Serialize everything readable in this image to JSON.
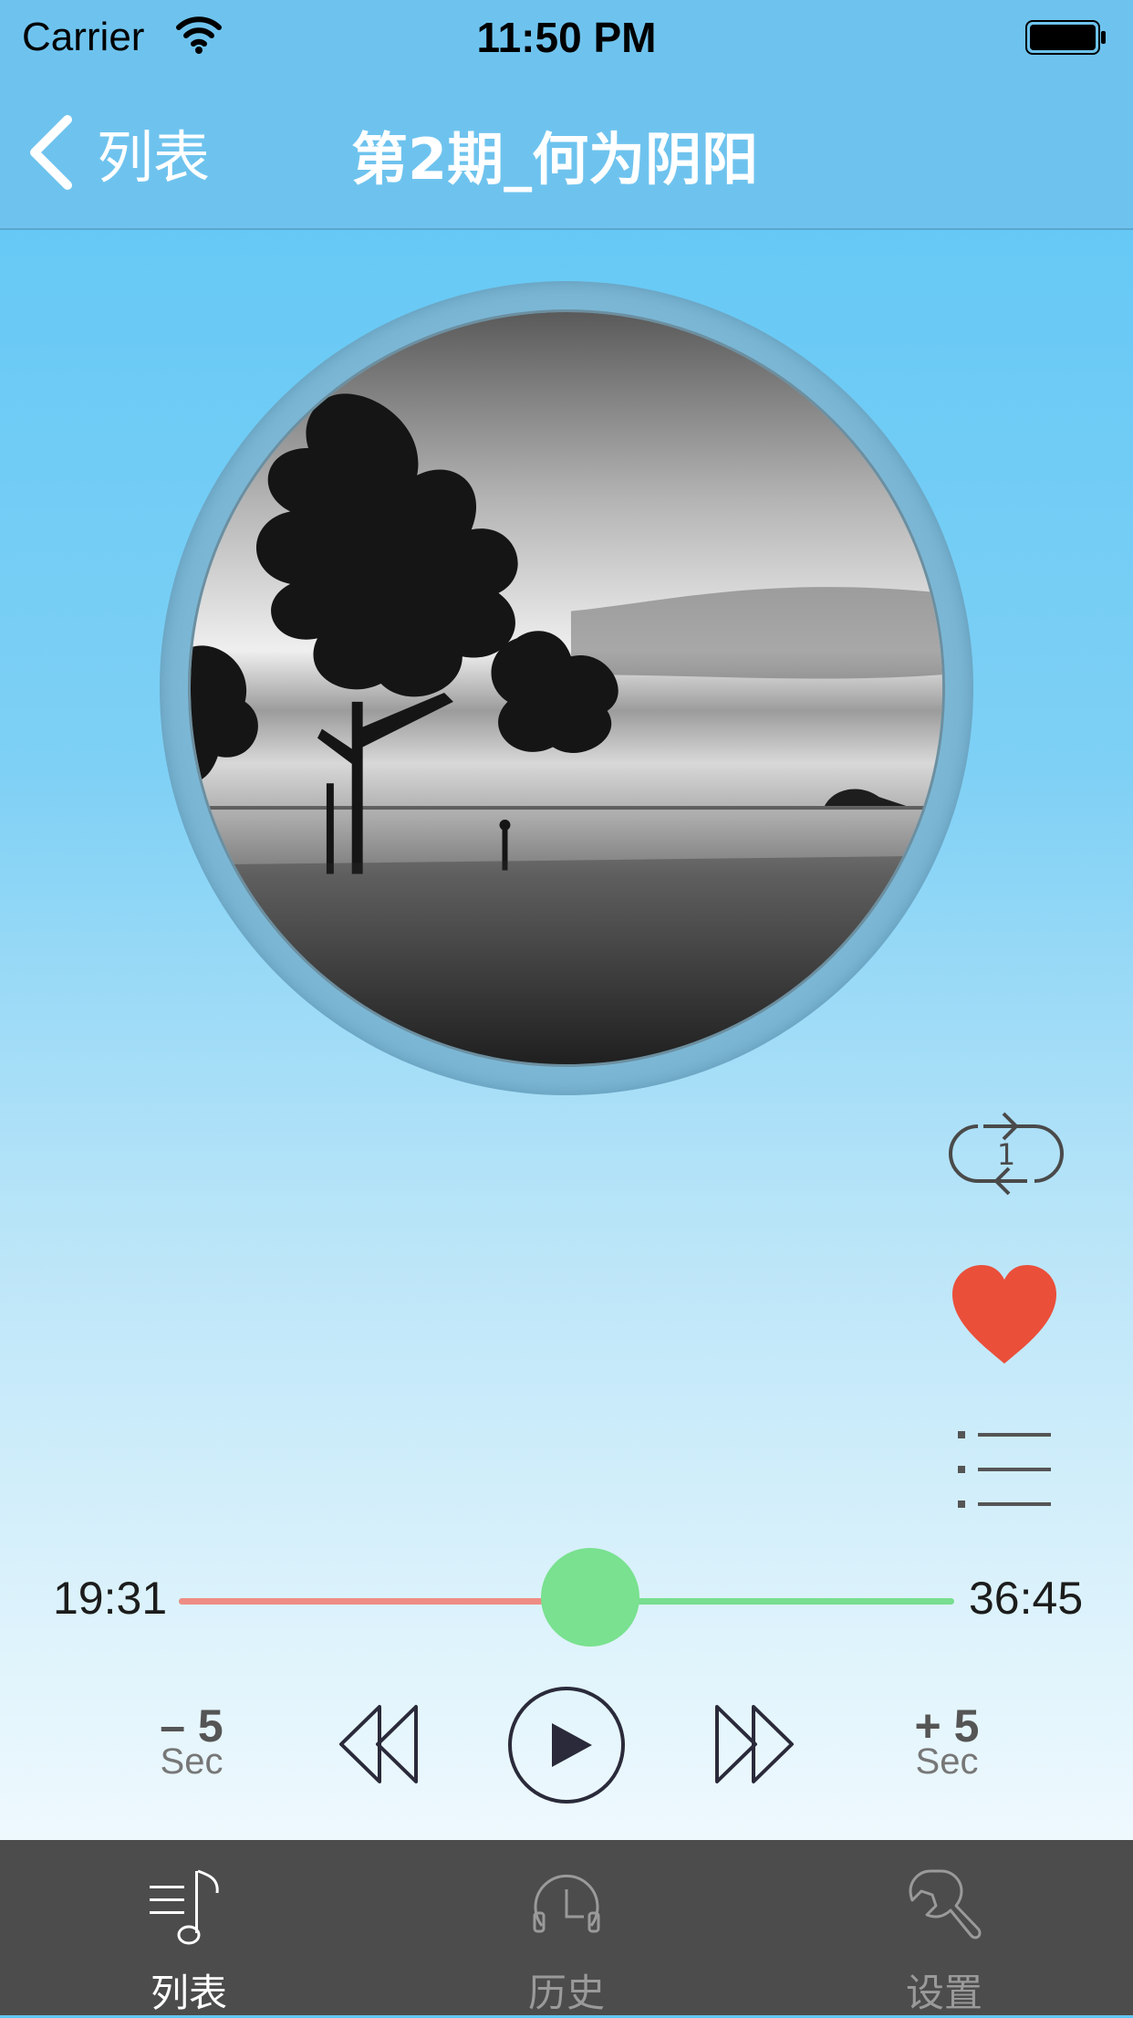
{
  "status_bar": {
    "carrier": "Carrier",
    "time": "11:50 PM"
  },
  "nav": {
    "back_label": "列表",
    "title": "第2期_何为阴阳"
  },
  "album_art": {
    "description_icon": "album-art-image"
  },
  "side_controls": {
    "repeat_icon": "repeat-one-icon",
    "favorite_icon": "heart-icon",
    "favorite_color": "#ea4f3a",
    "playlist_icon": "list-icon"
  },
  "player": {
    "current_time": "19:31",
    "total_time": "36:45",
    "progress": 0.531,
    "played_color": "#ee8d85",
    "remaining_color": "#78de90",
    "skip_back": {
      "top": "– 5",
      "bottom": "Sec"
    },
    "skip_forward": {
      "top": "+ 5",
      "bottom": "Sec"
    }
  },
  "tabs": [
    {
      "label": "列表",
      "icon": "music-list-icon",
      "active": true
    },
    {
      "label": "历史",
      "icon": "history-clock-icon",
      "active": false
    },
    {
      "label": "设置",
      "icon": "wrench-icon",
      "active": false
    }
  ],
  "colors": {
    "nav_bg": "#6ec3ee",
    "tabbar_bg": "#4c4c4c",
    "tab_active": "#ffffff",
    "tab_inactive": "#9a9a9a"
  }
}
